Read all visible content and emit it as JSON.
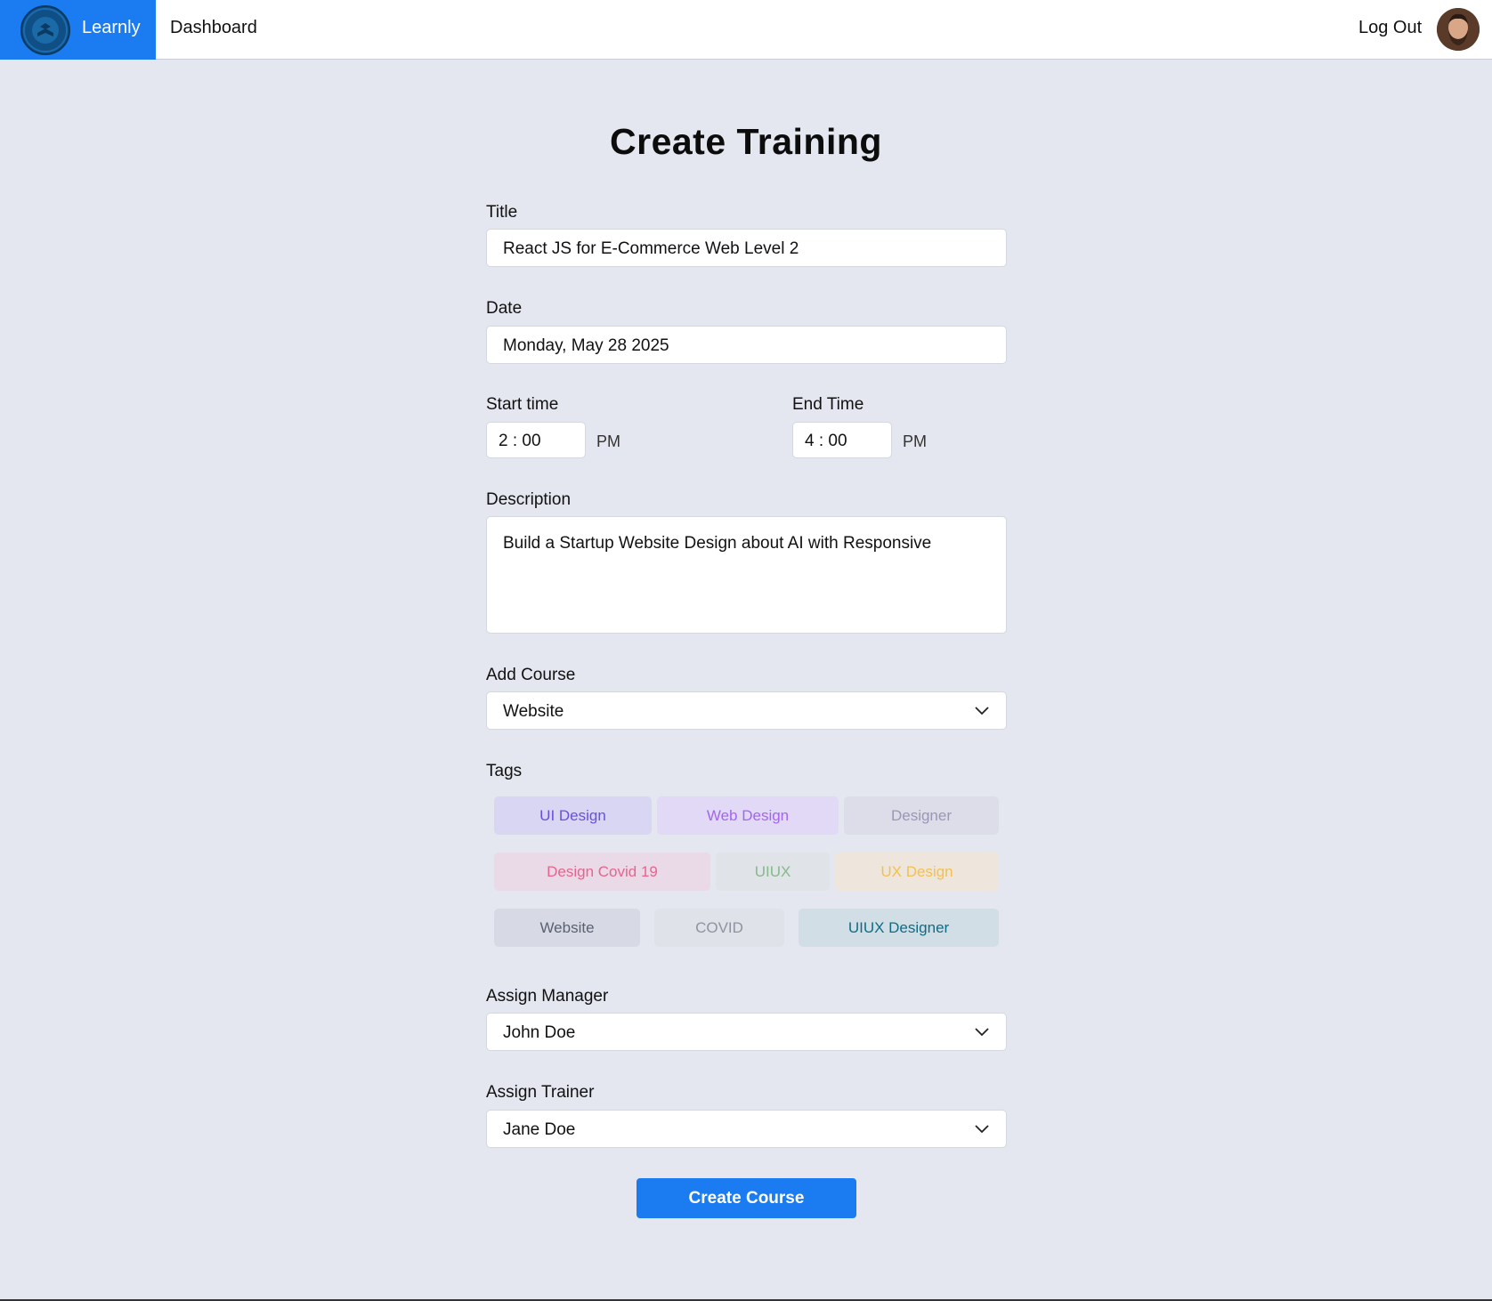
{
  "header": {
    "brand": "Learnly",
    "nav_dashboard": "Dashboard",
    "logout": "Log Out"
  },
  "page": {
    "title": "Create Training"
  },
  "form": {
    "title_label": "Title",
    "title_value": "React JS for E-Commerce Web Level 2",
    "date_label": "Date",
    "date_value": "Monday, May 28 2025",
    "start_label": "Start time",
    "start_value": "2 : 00",
    "start_ampm": "PM",
    "end_label": "End Time",
    "end_value": "4 : 00",
    "end_ampm": "PM",
    "description_label": "Description",
    "description_value": "Build a Startup Website Design about AI with Responsive",
    "course_label": "Add Course",
    "course_value": "Website",
    "tags_label": "Tags",
    "tags": [
      {
        "label": "UI Design",
        "bg": "#d8d6f3",
        "fg": "#6a4fe0"
      },
      {
        "label": "Web Design",
        "bg": "#e1d9f5",
        "fg": "#a466ee"
      },
      {
        "label": "Designer",
        "bg": "#dddde9",
        "fg": "#9a97b6"
      },
      {
        "label": "Design Covid 19",
        "bg": "#ead9e6",
        "fg": "#e8648f"
      },
      {
        "label": "UIUX",
        "bg": "#e0e3e8",
        "fg": "#86b98b"
      },
      {
        "label": "UX Design",
        "bg": "#eee5dd",
        "fg": "#f2c14e"
      },
      {
        "label": "Website",
        "bg": "#d7dae4",
        "fg": "#596174"
      },
      {
        "label": "COVID",
        "bg": "#e0e2ea",
        "fg": "#8f93a0"
      },
      {
        "label": "UIUX Designer",
        "bg": "#d2dee5",
        "fg": "#0e6d86"
      }
    ],
    "manager_label": "Assign Manager",
    "manager_value": "John Doe",
    "trainer_label": "Assign Trainer",
    "trainer_value": "Jane Doe",
    "submit_label": "Create Course"
  }
}
